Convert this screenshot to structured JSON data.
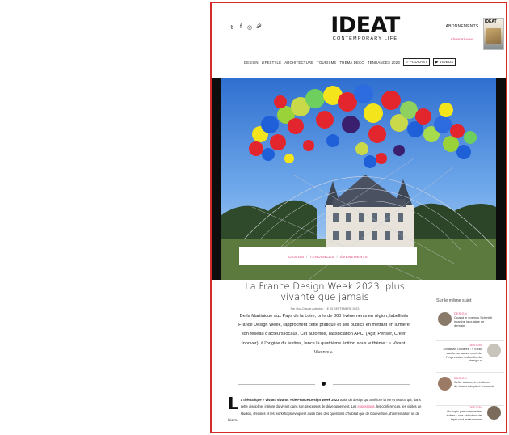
{
  "header": {
    "social_icons": [
      "twitter-icon",
      "facebook-icon",
      "instagram-icon",
      "pinterest-icon"
    ],
    "social_glyphs": [
      "𝕥",
      "f",
      "◎",
      "𝒫"
    ],
    "logo": "IDEAT",
    "logo_tagline": "CONTEMPORARY LIFE",
    "subscribe_label": "ABONNEMENTS",
    "subscribe_link": "Abonnez-vous",
    "magazine_title": "IDEAT"
  },
  "nav": {
    "items": [
      "DESIGN",
      "LIFESTYLE",
      "ARCHITECTURE",
      "TOURISME",
      "THÈMA DÉCO",
      "TENDANCES 2023"
    ],
    "pills": [
      "▷ PODCAST",
      "▶ VIDEOS"
    ]
  },
  "hero": {
    "breadcrumb": [
      "DESIGN",
      "TENDANCES",
      "ÉVÈNEMENTS"
    ],
    "breadcrumb_separator": "/"
  },
  "article": {
    "title": "La France Design Week 2023, plus vivante que jamais",
    "byline": "Par Guy-Claude Agboton  ·  LE 05 SEPTEMBRE 2023",
    "chapo": "De la Martinique aux Pays de la Loire, près de 300 événements en région, labellisés France Design Week, rapprochent cette pratique et ses publics en mettant en lumière son réseau d'acteurs locaux. Cet automne, l'association APCI (Agir, Penser, Créer, Innover), à l'origine du festival, lance la quatrième édition sous le thème : « Vivant, Vivants ».",
    "dropcap": "L",
    "body_lead": "a thématique « Vivant, vivants » de France Design Week 2023",
    "body_1": " traite du design qui améliore la vie et tout ce qui, dans cette discipline, intègre du vivant dans son processus de développement. Les ",
    "body_link": "expositions",
    "body_2": ", les conférences, les visites de studios, d'écoles et les workshops evoquent aussi bien des questions d'habitat que de biodiversité, d'alimentation ou de loisirs."
  },
  "sidebar": {
    "heading": "Sur le même sujet",
    "items": [
      {
        "category": "DESIGN",
        "text": "Quand le cosmos Schmidt imagine la cuisine de demain",
        "align": "left",
        "thumb_color": "#8a7a6a"
      },
      {
        "category": "DESIGN",
        "text": "Jonathan Olivares : « Ensil canfiesse au sommet de l'expression culturelle du design »",
        "align": "right",
        "thumb_color": "#c9c4bb"
      },
      {
        "category": "DESIGN",
        "text": "Cette saison, les éditeurs de tissus adoptent les mode",
        "align": "left",
        "thumb_color": "#9c7b66"
      },
      {
        "category": "DESIGN",
        "text": "Un topic pas comme les autres : une sélection de tapis vert environnem",
        "align": "right",
        "thumb_color": "#7a6b5c"
      }
    ]
  },
  "colors": {
    "accent": "#e0457a",
    "frame": "#d42a2a"
  }
}
